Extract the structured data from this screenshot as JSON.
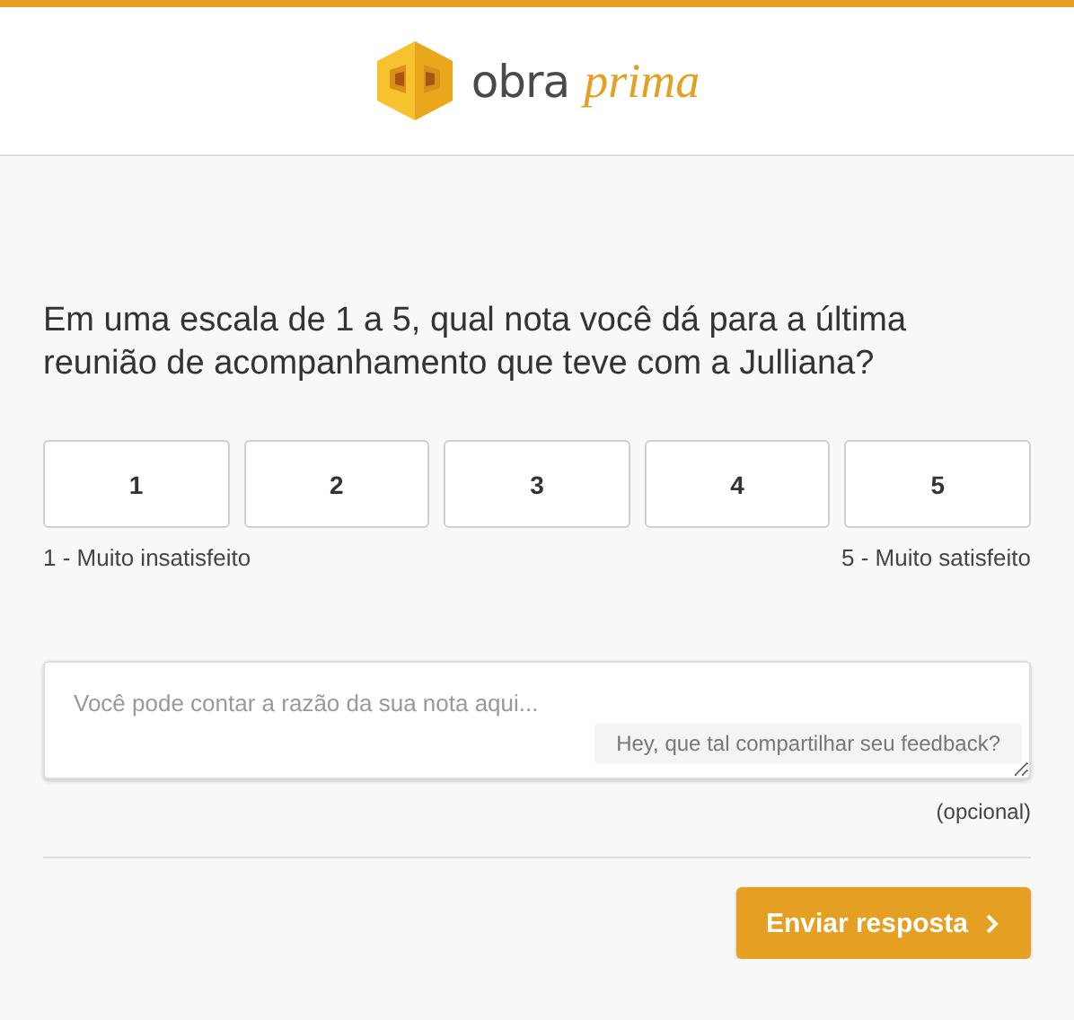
{
  "logo": {
    "word": "obra",
    "script": "prima"
  },
  "question": "Em uma escala de 1 a 5, qual nota você dá para a última reunião de acompanhamento que teve com a Julliana?",
  "scale": [
    {
      "label": "1",
      "selected": false
    },
    {
      "label": "2",
      "selected": false
    },
    {
      "label": "3",
      "selected": false
    },
    {
      "label": "4",
      "selected": false
    },
    {
      "label": "5",
      "selected": false
    }
  ],
  "scale_min_label": "1 - Muito insatisfeito",
  "scale_max_label": "5 - Muito satisfeito",
  "comment": {
    "placeholder": "Você pode contar a razão da sua nota aqui...",
    "hint": "Hey, que tal compartilhar seu feedback?",
    "note": "(opcional)"
  },
  "submit": {
    "label": "Enviar resposta"
  }
}
